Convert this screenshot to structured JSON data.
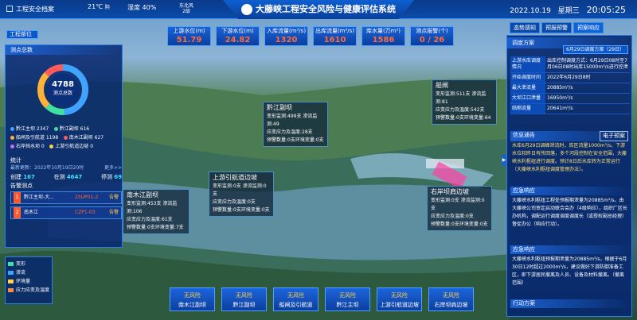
{
  "topbar": {
    "app_name": "工程安全档案",
    "temp": "21℃",
    "temp_sub": "阴",
    "humidity": "湿度 40%",
    "wind": "东北风",
    "wind_level": "2级",
    "title": "大藤峡工程安全风险与健康评估系统",
    "date": "2022.10.19",
    "weekday": "星期三",
    "time": "20:05:25"
  },
  "stats": [
    {
      "label": "上游水位(m)",
      "value": "51.79"
    },
    {
      "label": "下游水位(m)",
      "value": "24.82"
    },
    {
      "label": "入库流量(m³/s)",
      "value": "1320"
    },
    {
      "label": "出库流量(m³/s)",
      "value": "1610"
    },
    {
      "label": "库水量(万m³)",
      "value": "1586"
    },
    {
      "label": "测点报警(个)",
      "value": "0 / 26"
    }
  ],
  "left": {
    "tab": "工程部位",
    "header": "测点总数",
    "total": "4788",
    "total_label": "测点总数",
    "legend": [
      {
        "name": "黔江主坝 2347",
        "color": "#3fa3ff"
      },
      {
        "name": "黔江副坝 616",
        "color": "#3fe0a0"
      },
      {
        "name": "船闸及引航道 1198",
        "color": "#ffb23a"
      },
      {
        "name": "南木江副坝 627",
        "color": "#ff5b5b"
      },
      {
        "name": "右岸挡水坝 0",
        "color": "#c86bff"
      },
      {
        "name": "上游引航道边坡 0",
        "color": "#ffd24a"
      }
    ],
    "stat_title": "统计",
    "update": "最新更新：2022年10月19日20时",
    "more": "更多>>",
    "counts": {
      "created": "创建",
      "created_val": "167",
      "online": "在测",
      "online_val": "4647",
      "stopped": "停测",
      "stopped_val": "69"
    },
    "alarm_title": "告警测点",
    "alarms": [
      {
        "n": "1",
        "name": "黔江主坝-大...",
        "code": "25UP01-2",
        "tag": "告警"
      },
      {
        "n": "2",
        "name": "南木江",
        "code": "CZP1-03",
        "tag": "告警"
      }
    ],
    "map_legend": [
      {
        "name": "变形",
        "color": "#3fe0a0"
      },
      {
        "name": "渗流",
        "color": "#3fa3ff"
      },
      {
        "name": "环境量",
        "color": "#ffd24a"
      },
      {
        "name": "应力应变及温度",
        "color": "#ff8a3a"
      }
    ]
  },
  "map_cards": [
    {
      "title": "黔江副坝",
      "lines": [
        "变形监测:499支 渗流监测:49",
        "应变应力及温度:28支",
        "预警数量:0支环境变量:0支"
      ]
    },
    {
      "title": "船闸",
      "lines": [
        "变形监测:511支 渗流监测:81",
        "应变应力及温度:542支",
        "预警数量:0支环境变量:64"
      ]
    },
    {
      "title": "上游引航道边坡",
      "lines": [
        "变形监测:0支   渗流监测:0支",
        "应变应力及温度:0支",
        "预警数量:0支环境变量:0支"
      ]
    },
    {
      "title": "南木江副坝",
      "lines": [
        "变形监测:453支 渗流监测:106",
        "应变应力及温度:61支",
        "预警数量:0支环境变量:7支"
      ]
    },
    {
      "title": "右岸坝肩边坡",
      "lines": [
        "变形监测:0支   渗流监测:0支",
        "应变应力及温度:0支",
        "预警数量:0支环境变量:0支"
      ]
    }
  ],
  "bottom_nav": [
    {
      "status": "无风险",
      "name": "南木江副坝"
    },
    {
      "status": "无风险",
      "name": "黔江副坝"
    },
    {
      "status": "无风险",
      "name": "船闸及引航道"
    },
    {
      "status": "无风险",
      "name": "黔江主坝"
    },
    {
      "status": "无风险",
      "name": "上游引航道边坡"
    },
    {
      "status": "无风险",
      "name": "右岸坝肩边坡"
    }
  ],
  "right": {
    "tabs": [
      "态势感知",
      "预报预警",
      "预案响应"
    ],
    "section1": "调度方案",
    "select": "6月29日调度方案（29日）",
    "table": [
      {
        "k": "上游水库调度情况",
        "v": "出库控制调度方式：6月29日08时至7月06日08时出库15000m³/s进行控泄"
      },
      {
        "k": "开始调度时间",
        "v": "2022年6月29日8时"
      },
      {
        "k": "最大泄流量",
        "v": "20885m³/s"
      },
      {
        "k": "大坝江口泄量",
        "v": "16950m³/s"
      },
      {
        "k": "临侧流量",
        "v": "20641m³/s"
      }
    ],
    "info_title": "信息通告",
    "info_btn": "电子预案",
    "info_text": "水库6月29日调峰泄流时，库区流量1000m³/s，下游水位较昨日有所回落，多个河段控制在安全范围，大藤峡水利枢纽进行调度。预计8日后水库转为正常运行（大藤峡水利枢纽调度管理办法）。",
    "resp_title": "应急响应",
    "resp_text": "大藤峡水利枢纽工程处预报期泄量为20885m³/s，由大藤峡公司审定启动联合会办（4级响应），组织厂区长办机构，调配运行调度调度调度长（或授权副总经理）督促办公（响应行动）。",
    "resp2_title": "应急响应",
    "resp2_text": "大藤峡水利枢纽预报期泄量为20885m³/s，根据于6月30日12时超过2000m³/s，建议做好下游防御准备工区，即下游居民撤离及人员、设备及材料撤离。（撤离范围）",
    "action_title": "行动方案"
  }
}
